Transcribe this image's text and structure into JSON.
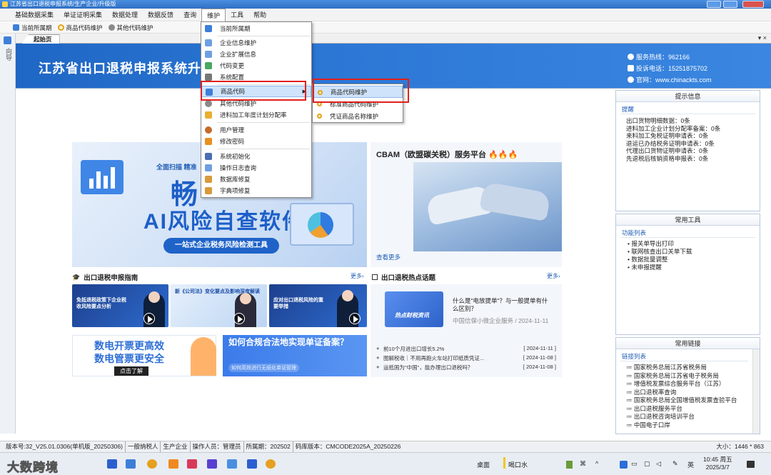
{
  "window": {
    "title": "江苏省出口退税申报系统/生产企业/升级版"
  },
  "menubar": [
    "基础数据采集",
    "单证证明采集",
    "数据处理",
    "数据反馈",
    "查询",
    "维护",
    "工具",
    "帮助"
  ],
  "quickbar": [
    "当前所属期",
    "商品代码维护",
    "其他代码维护"
  ],
  "leftstrip": {
    "label": "向导"
  },
  "tab": {
    "start": "起始页",
    "tools": "▾ ×"
  },
  "banner": {
    "title": "江苏省出口退税申报系统升级版",
    "hotline": "服务热线：962166",
    "complaint": "投诉电话：15251875702",
    "website": "官网：www.chinackts.com"
  },
  "promo": {
    "scan": "全面扫描 精准",
    "big1": "畅",
    "big2": "AI风险自查软件",
    "pill": "一站式企业税务风险检测工具"
  },
  "cbam": {
    "title": "CBAM（欧盟碳关税）服务平台",
    "fire": "🔥🔥🔥",
    "more": "查看更多"
  },
  "guide": {
    "title": "出口退税申报指南",
    "more": "更多›"
  },
  "hot": {
    "title": "出口退税热点话题",
    "more": "更多›"
  },
  "thumbs": [
    {
      "caption": "免抵退税政策下企业税收风险要点分析"
    },
    {
      "caption": "新《公司法》变化要点及影响深度解读"
    },
    {
      "caption": "应对出口退税风险的重要举措"
    }
  ],
  "ads": {
    "ad1_line1": "数电开票更高效",
    "ad1_line2": "数电管票更安全",
    "ad1_btn": "点击了解",
    "ad2_line1": "如何合规合法地实现单证备案？",
    "ad2_line2": "如何高效进行无纸化单证管理"
  },
  "hotcard": {
    "img_label": "热点财税资讯",
    "title": "什么是\"电放提单\"？与一般提单有什么区别？",
    "sub": "中国信保小微企业服务 / 2024-11-11"
  },
  "news": [
    {
      "title": "前10个月进出口增长5.2%",
      "date": "[ 2024-11-11 ]"
    },
    {
      "title": "图解税收｜不用再跑火车站打印纸质凭证...",
      "date": "[ 2024-11-08 ]"
    },
    {
      "title": "运抵国为\"中国\"，能办理出口退税吗？",
      "date": "[ 2024-11-08 ]"
    }
  ],
  "tips": {
    "header": "提示信息",
    "sub": "提醒",
    "lines": [
      "出口货物明细数据：0条",
      "进料加工企业计划分配率备案：0条",
      "来料加工免税证明申请表：0条",
      "退运已办结税务证明申请表：0条",
      "代理出口货物证明申请表：0条",
      "先退税后核销资格申报表：0条"
    ]
  },
  "tools": {
    "header": "常用工具",
    "sub": "功能列表",
    "items": [
      "报关单导出打印",
      "联网核查出口关单下载",
      "数据批量调整",
      "未申报提醒"
    ]
  },
  "links": {
    "header": "常用链接",
    "sub": "链接列表",
    "items": [
      "国家税务总局江苏省税务局",
      "国家税务总局江苏省电子税务局",
      "增值税发票综合服务平台（江苏）",
      "出口退税率查询",
      "国家税务总局全国增值税发票查验平台",
      "出口退税服务平台",
      "出口退税咨询培训平台",
      "中国电子口岸"
    ]
  },
  "dropdown": {
    "items": [
      "当前所属期",
      "企业信息维护",
      "企业扩展信息",
      "代码变更",
      "系统配置",
      "商品代码",
      "其他代码维护",
      "进料加工年度计划分配率",
      "用户管理",
      "修改密码",
      "系统初始化",
      "操作日志查询",
      "数据库修复",
      "字典项修复"
    ]
  },
  "submenu": {
    "items": [
      "商品代码维护",
      "标准商品代码维护",
      "凭证商品名称维护"
    ]
  },
  "status": {
    "segments": [
      "版本号:32_V25.01.0306(单机版_20250306)",
      "一般纳税人",
      "生产企业",
      "操作人员：管理员",
      "所属期：202502",
      "码库版本：CMCODE2025A_20250226"
    ],
    "size": "大小：1446 * 863"
  },
  "taskbar": {
    "brand": "大数跨境",
    "desktop": "桌面",
    "water": "喝口水",
    "ime": "英",
    "time": "10:45 周五",
    "date": "2025/3/7"
  },
  "colors": {
    "banner": "#2d78d6",
    "accent": "#1f5db4",
    "highlight": "#e0201c"
  }
}
